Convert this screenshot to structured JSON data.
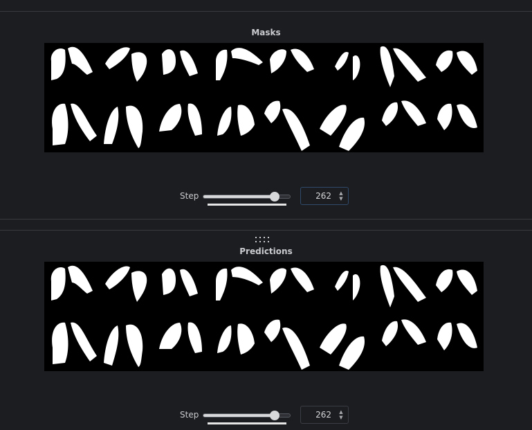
{
  "panels": [
    {
      "title": "Masks",
      "step_label": "Step",
      "step_value": "262",
      "slider_fraction": 0.86,
      "image_description_name": "masks-grid-image"
    },
    {
      "title": "Predictions",
      "step_label": "Step",
      "step_value": "262",
      "slider_fraction": 0.86,
      "image_description_name": "predictions-grid-image"
    }
  ],
  "icons": {
    "drag_handle": "drag-handle-icon",
    "spinner": "spinner-arrows-icon"
  },
  "colors": {
    "background": "#1c1d20",
    "mask_fill": "#ffffff",
    "image_background": "#000000"
  }
}
